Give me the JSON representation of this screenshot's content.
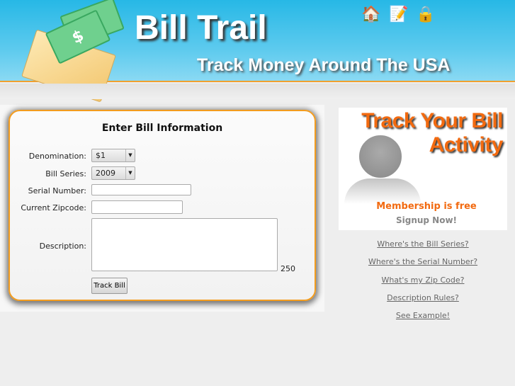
{
  "header": {
    "title": "Bill Trail",
    "tagline": "Track Money Around The USA",
    "nav_icons": [
      "home-icon",
      "edit-icon",
      "lock-icon"
    ],
    "accent": "#f39c1e"
  },
  "form": {
    "title": "Enter Bill Information",
    "denomination_label": "Denomination:",
    "denomination_value": "$1",
    "series_label": "Bill Series:",
    "series_value": "2009",
    "serial_label": "Serial Number:",
    "serial_value": "",
    "zip_label": "Current Zipcode:",
    "zip_value": "",
    "description_label": "Description:",
    "description_value": "",
    "char_count": "250",
    "submit_label": "Track Bill"
  },
  "promo": {
    "title_line1": "Track Your Bill",
    "title_line2": "Activity",
    "membership": "Membership is free",
    "signup": "Signup Now!"
  },
  "help_links": [
    "Where's the Bill Series?",
    "Where's the Serial Number?",
    "What's my Zip Code?",
    "Description Rules?",
    "See Example!"
  ]
}
